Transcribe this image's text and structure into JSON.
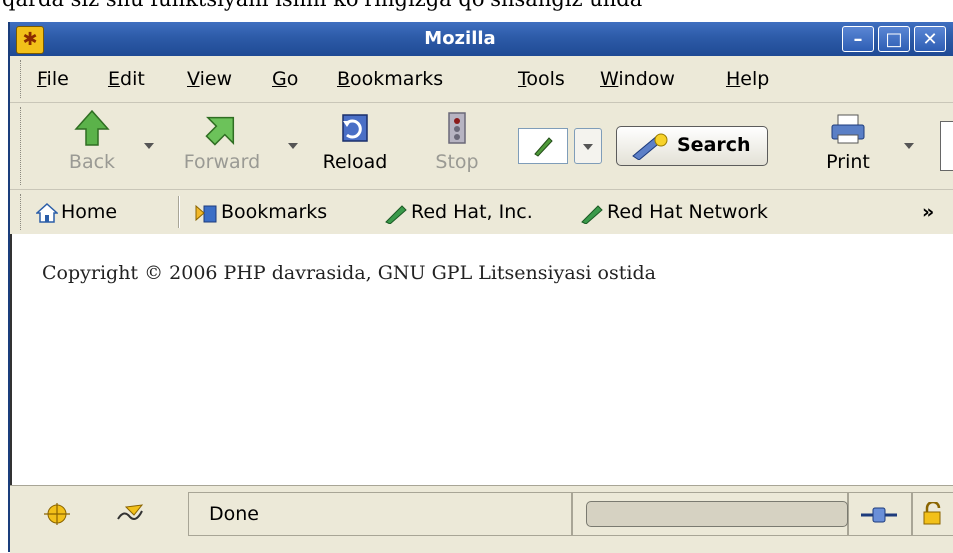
{
  "page_caption": "qarda siz shu funktsiyani ishni ko'ringizga qo'shsangiz unda",
  "window": {
    "title": "Mozilla",
    "min_glyph": "–",
    "max_glyph": "□",
    "close_glyph": "✕"
  },
  "menu": [
    {
      "key": "F",
      "rest": "ile"
    },
    {
      "key": "E",
      "rest": "dit"
    },
    {
      "key": "V",
      "rest": "iew"
    },
    {
      "key": "G",
      "rest": "o"
    },
    {
      "key": "B",
      "rest": "ookmarks"
    },
    {
      "key": "T",
      "rest": "ools"
    },
    {
      "key": "W",
      "rest": "indow"
    },
    {
      "key": "H",
      "rest": "elp"
    }
  ],
  "nav": {
    "back": "Back",
    "forward": "Forward",
    "reload": "Reload",
    "stop": "Stop",
    "search": "Search",
    "print": "Print"
  },
  "personal": {
    "home": "Home",
    "bookmarks": "Bookmarks",
    "redhat": "Red Hat, Inc.",
    "rhn": "Red Hat Network",
    "more": "»"
  },
  "content": {
    "copyright": "Copyright © 2006 PHP davrasida, GNU GPL Litsensiyasi ostida"
  },
  "status": {
    "text": "Done",
    "progress": 0
  },
  "icons": {
    "app": "mozilla-icon",
    "back": "back-arrow-icon",
    "forward": "forward-arrow-icon",
    "reload": "reload-icon",
    "stop": "stop-icon",
    "search": "search-icon",
    "print": "printer-icon",
    "home": "home-icon",
    "bookmarks": "bookmarks-icon",
    "link": "bookmark-link-icon",
    "status_1": "navigator-icon",
    "status_2": "composer-icon",
    "online": "online-plug-icon",
    "lock": "padlock-icon"
  }
}
